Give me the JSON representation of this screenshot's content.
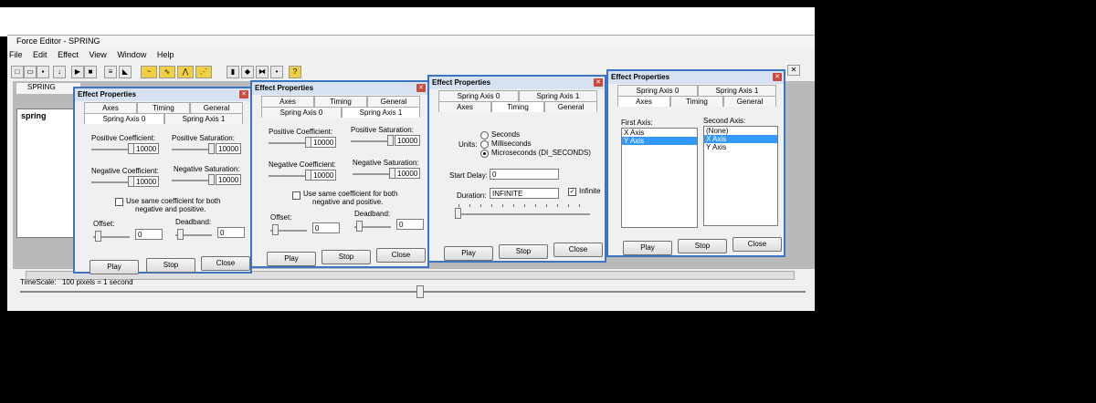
{
  "app": {
    "title": "Force Editor - SPRING",
    "menu": [
      "File",
      "Edit",
      "Effect",
      "View",
      "Window",
      "Help"
    ],
    "child_title": "SPRING",
    "track_label": "spring",
    "timescale_label": "TimeScale:",
    "timescale_value": "100 pixels = 1 second"
  },
  "dialog_title": "Effect Properties",
  "buttons": {
    "play": "Play",
    "stop": "Stop",
    "close": "Close"
  },
  "tabs": {
    "axes": "Axes",
    "timing": "Timing",
    "general": "General",
    "spring0": "Spring Axis 0",
    "spring1": "Spring Axis 1"
  },
  "spring": {
    "pos_coef_label": "Positive Coefficient:",
    "pos_sat_label": "Positive Saturation:",
    "neg_coef_label": "Negative Coefficient:",
    "neg_sat_label": "Negative Saturation:",
    "pos_coef": "10000",
    "pos_sat": "10000",
    "neg_coef": "10000",
    "neg_sat": "10000",
    "same_coef_line1": "Use same coefficient for both",
    "same_coef_line2": "negative and positive.",
    "offset_label": "Offset:",
    "deadband_label": "Deadband:",
    "offset": "0",
    "deadband": "0"
  },
  "timing": {
    "units_label": "Units:",
    "opt_seconds": "Seconds",
    "opt_ms": "Milliseconds",
    "opt_us": "Microseconds (DI_SECONDS)",
    "start_delay_label": "Start Delay:",
    "start_delay": "0",
    "duration_label": "Duration:",
    "duration": "INFINITE",
    "infinite_label": "Infinite"
  },
  "axes": {
    "first_label": "First Axis:",
    "second_label": "Second Axis:",
    "first_items": [
      "X Axis",
      "Y Axis"
    ],
    "first_selected": 1,
    "second_items": [
      "(None)",
      "X Axis",
      "Y Axis"
    ],
    "second_selected": 1
  },
  "colors": {
    "accent": "#3c74c4",
    "selection": "#3399ff"
  }
}
